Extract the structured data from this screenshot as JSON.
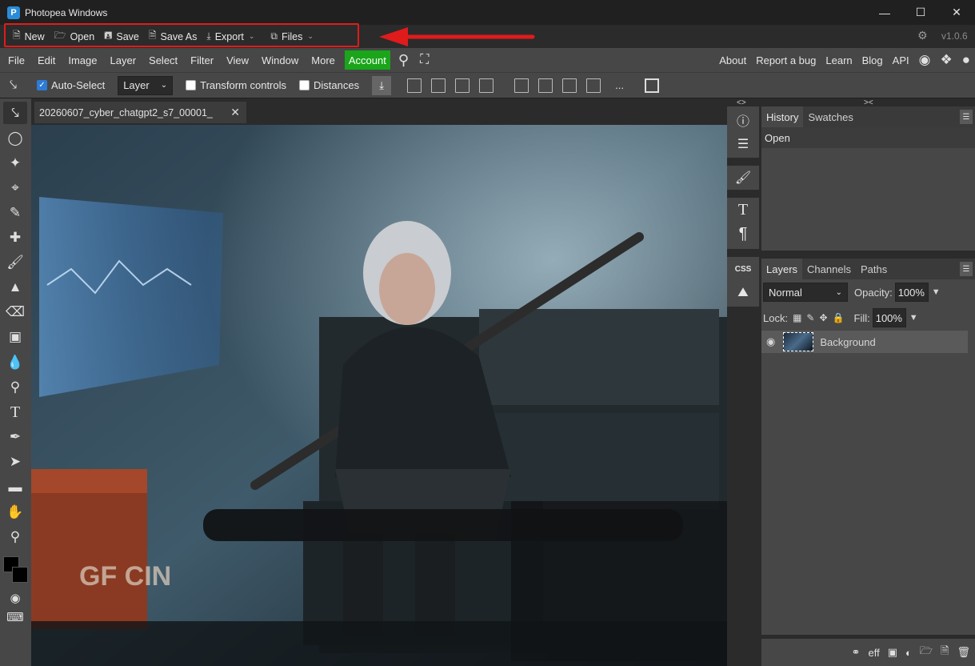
{
  "window": {
    "title": "Photopea Windows",
    "app_icon": "photopea-logo-icon"
  },
  "filebar": {
    "items": [
      {
        "label": "New",
        "icon": "new-file-icon"
      },
      {
        "label": "Open",
        "icon": "folder-open-icon"
      },
      {
        "label": "Save",
        "icon": "save-icon"
      },
      {
        "label": "Save As",
        "icon": "save-as-icon"
      },
      {
        "label": "Export",
        "icon": "download-icon",
        "dropdown": true
      },
      {
        "label": "Files",
        "icon": "files-icon",
        "dropdown": true
      }
    ],
    "version": "v1.0.6",
    "highlight_color": "#e01b1b"
  },
  "menubar": {
    "items": [
      "File",
      "Edit",
      "Image",
      "Layer",
      "Select",
      "Filter",
      "View",
      "Window",
      "More"
    ],
    "account": "Account",
    "right_items": [
      "About",
      "Report a bug",
      "Learn",
      "Blog",
      "API"
    ],
    "account_color": "#1aa51a"
  },
  "options": {
    "auto_select": "Auto-Select",
    "auto_select_checked": true,
    "layer_select": "Layer",
    "transform_controls": "Transform controls",
    "distances": "Distances",
    "more": "..."
  },
  "document": {
    "tab_title": "20260607_cyber_chatgpt2_s7_00001_"
  },
  "canvas": {
    "crate_text": "GF CIN"
  },
  "history": {
    "tabs": [
      "History",
      "Swatches"
    ],
    "entries": [
      "Open"
    ]
  },
  "layers": {
    "tabs": [
      "Layers",
      "Channels",
      "Paths"
    ],
    "blend_mode": "Normal",
    "opacity_label": "Opacity:",
    "opacity_value": "100%",
    "lock_label": "Lock:",
    "fill_label": "Fill:",
    "fill_value": "100%",
    "layer_name": "Background",
    "bottom_eff": "eff"
  },
  "panel_toggles": {
    "left": "<>",
    "right": "><"
  }
}
